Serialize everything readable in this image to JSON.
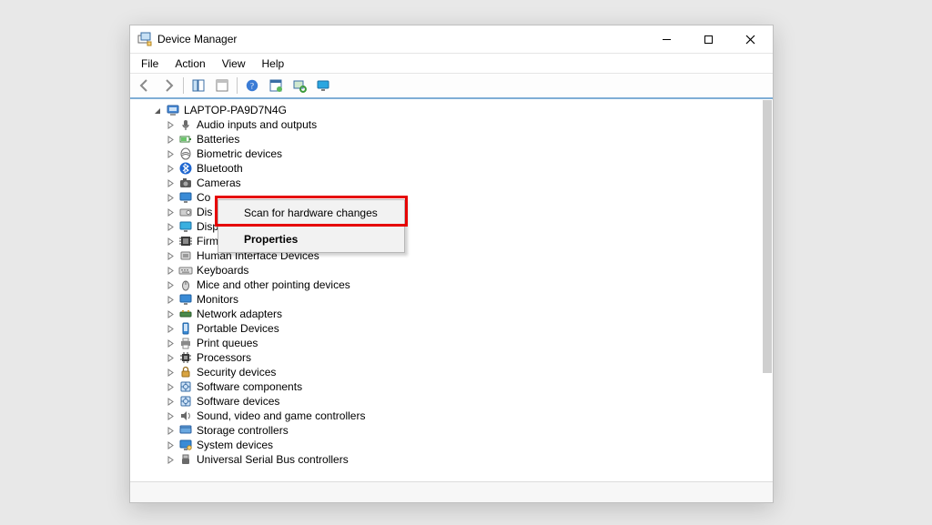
{
  "window": {
    "title": "Device Manager"
  },
  "menubar": {
    "file": "File",
    "action": "Action",
    "view": "View",
    "help": "Help"
  },
  "toolbar": {
    "back": "Back",
    "forward": "Forward",
    "showhide": "Show/Hide Console Tree",
    "props": "Properties",
    "help": "Help",
    "update": "Update driver",
    "scan": "Scan for hardware changes",
    "monitor": "Add legacy hardware"
  },
  "tree": {
    "root": {
      "label": "LAPTOP-PA9D7N4G",
      "icon": "computer-icon"
    },
    "items": [
      {
        "label": "Audio inputs and outputs",
        "icon": "audio-icon"
      },
      {
        "label": "Batteries",
        "icon": "battery-icon"
      },
      {
        "label": "Biometric devices",
        "icon": "biometric-icon"
      },
      {
        "label": "Bluetooth",
        "icon": "bluetooth-icon"
      },
      {
        "label": "Cameras",
        "icon": "camera-icon"
      },
      {
        "label": "Co",
        "icon": "monitor-icon"
      },
      {
        "label": "Dis",
        "icon": "disk-icon"
      },
      {
        "label": "Disp",
        "icon": "display-icon"
      },
      {
        "label": "Firmware",
        "icon": "firmware-icon"
      },
      {
        "label": "Human Interface Devices",
        "icon": "hid-icon"
      },
      {
        "label": "Keyboards",
        "icon": "keyboard-icon"
      },
      {
        "label": "Mice and other pointing devices",
        "icon": "mouse-icon"
      },
      {
        "label": "Monitors",
        "icon": "monitor-icon"
      },
      {
        "label": "Network adapters",
        "icon": "network-icon"
      },
      {
        "label": "Portable Devices",
        "icon": "portable-icon"
      },
      {
        "label": "Print queues",
        "icon": "printer-icon"
      },
      {
        "label": "Processors",
        "icon": "cpu-icon"
      },
      {
        "label": "Security devices",
        "icon": "security-icon"
      },
      {
        "label": "Software components",
        "icon": "software-icon"
      },
      {
        "label": "Software devices",
        "icon": "software-icon"
      },
      {
        "label": "Sound, video and game controllers",
        "icon": "sound-icon"
      },
      {
        "label": "Storage controllers",
        "icon": "storage-icon"
      },
      {
        "label": "System devices",
        "icon": "system-icon"
      },
      {
        "label": "Universal Serial Bus controllers",
        "icon": "usb-icon"
      }
    ]
  },
  "contextmenu": {
    "scan": "Scan for hardware changes",
    "properties": "Properties"
  }
}
